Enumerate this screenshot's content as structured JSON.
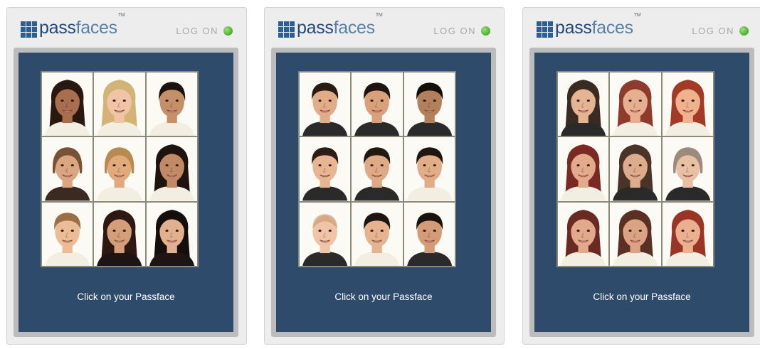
{
  "screens": [
    {
      "brand_part1": "pass",
      "brand_part2": "faces",
      "trademark": "TM",
      "logon_label": "LOG ON",
      "caption": "Click on your Passface",
      "faces": [
        {
          "skin": "#a86e4e",
          "hair": "#2a1710",
          "hair_style": "long",
          "shirt": "#f2eee2"
        },
        {
          "skin": "#f0c5a5",
          "hair": "#d4b377",
          "hair_style": "long",
          "shirt": "#f2eee2"
        },
        {
          "skin": "#c59068",
          "hair": "#1c120d",
          "hair_style": "bun",
          "shirt": "#f2eee2"
        },
        {
          "skin": "#d9a681",
          "hair": "#7a5134",
          "hair_style": "bob",
          "shirt": "#3a2a22"
        },
        {
          "skin": "#e2a97c",
          "hair": "#b88a50",
          "hair_style": "bob",
          "shirt": "#f2eee2"
        },
        {
          "skin": "#c28a64",
          "hair": "#1e130e",
          "hair_style": "long",
          "shirt": "#f2eee2"
        },
        {
          "skin": "#ecbc96",
          "hair": "#9c6e45",
          "hair_style": "short",
          "shirt": "#f2eee2"
        },
        {
          "skin": "#d59e7a",
          "hair": "#2e1812",
          "hair_style": "long",
          "shirt": "#1e1414"
        },
        {
          "skin": "#e0b08f",
          "hair": "#160e0b",
          "hair_style": "long",
          "shirt": "#1e1414"
        }
      ]
    },
    {
      "brand_part1": "pass",
      "brand_part2": "faces",
      "trademark": "TM",
      "logon_label": "LOG ON",
      "caption": "Click on your Passface",
      "faces": [
        {
          "skin": "#e3ac88",
          "hair": "#2a1c14",
          "hair_style": "short",
          "shirt": "#2a2a2a"
        },
        {
          "skin": "#d9a07a",
          "hair": "#1d140f",
          "hair_style": "short",
          "shirt": "#2a2a2a"
        },
        {
          "skin": "#b4805c",
          "hair": "#140e0a",
          "hair_style": "short",
          "shirt": "#2a2a2a"
        },
        {
          "skin": "#e8b592",
          "hair": "#2c1e16",
          "hair_style": "short",
          "shirt": "#2a2a2a"
        },
        {
          "skin": "#deaa86",
          "hair": "#231810",
          "hair_style": "short",
          "shirt": "#2a2a2a"
        },
        {
          "skin": "#e1ad89",
          "hair": "#201610",
          "hair_style": "short",
          "shirt": "#f2eee2"
        },
        {
          "skin": "#f0c4a6",
          "hair": "#c9a075",
          "hair_style": "buzz",
          "shirt": "#2a2a2a"
        },
        {
          "skin": "#e6b38f",
          "hair": "#1f1510",
          "hair_style": "short",
          "shirt": "#f2eee2"
        },
        {
          "skin": "#d39c77",
          "hair": "#1a120c",
          "hair_style": "short",
          "shirt": "#2a2a2a"
        }
      ]
    },
    {
      "brand_part1": "pass",
      "brand_part2": "faces",
      "trademark": "TM",
      "logon_label": "LOG ON",
      "caption": "Click on your Passface",
      "faces": [
        {
          "skin": "#e4b493",
          "hair": "#3a2a22",
          "hair_style": "long",
          "shirt": "#2a2a2a"
        },
        {
          "skin": "#e6b090",
          "hair": "#8e3a2c",
          "hair_style": "long",
          "shirt": "#f2eee2"
        },
        {
          "skin": "#f0b28e",
          "hair": "#a23a26",
          "hair_style": "long",
          "shirt": "#f2eee2"
        },
        {
          "skin": "#e3aa8c",
          "hair": "#7a2a22",
          "hair_style": "long",
          "shirt": "#f2eee2"
        },
        {
          "skin": "#dcac8c",
          "hair": "#4a3428",
          "hair_style": "long",
          "shirt": "#2a2a2a"
        },
        {
          "skin": "#e8c0a4",
          "hair": "#9c8a7e",
          "hair_style": "bob",
          "shirt": "#2a2a2a"
        },
        {
          "skin": "#e2a98c",
          "hair": "#6a2a22",
          "hair_style": "long",
          "shirt": "#f2eee2"
        },
        {
          "skin": "#dba283",
          "hair": "#5a3024",
          "hair_style": "long",
          "shirt": "#f2eee2"
        },
        {
          "skin": "#ebb090",
          "hair": "#9a3424",
          "hair_style": "long",
          "shirt": "#f2eee2"
        }
      ]
    }
  ]
}
